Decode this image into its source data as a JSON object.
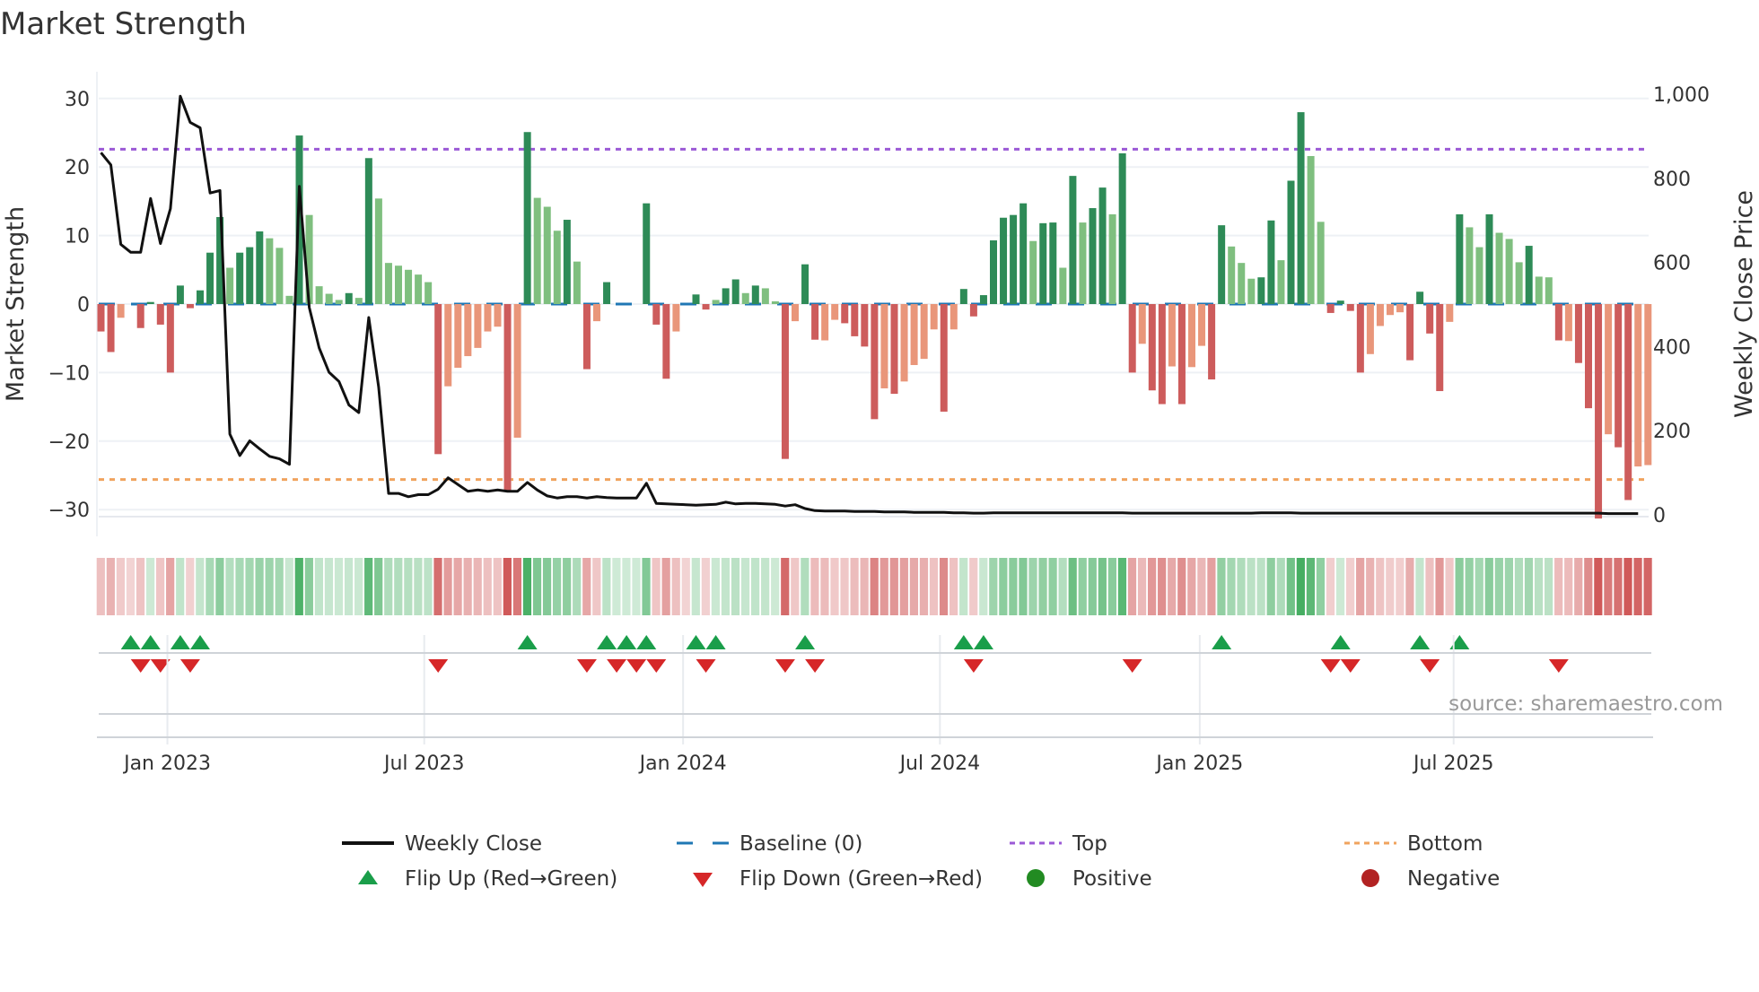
{
  "title": "Market Strength",
  "source": "source: sharemaestro.com",
  "colors": {
    "strong_pos": "#2e8b57",
    "weak_pos": "#7fbf7f",
    "strong_neg": "#cd5c5c",
    "weak_neg": "#e9967a",
    "close": "#111111",
    "baseline": "#1f77b4",
    "top": "#9b59d6",
    "bottom": "#f0a35e",
    "flip_up": "#1a9e4a",
    "flip_down": "#d62728",
    "positive": "#228b22",
    "negative": "#b22222"
  },
  "chart_data": {
    "type": "bar",
    "title": "Market Strength",
    "ylabel": "Market Strength",
    "y2label": "Weekly Close Price",
    "ylim": [
      -31.5,
      31.5
    ],
    "y2lim": [
      0,
      1000
    ],
    "yticks": [
      "30",
      "20",
      "10",
      "0",
      "−10",
      "−20",
      "−30"
    ],
    "ytick_values": [
      30,
      20,
      10,
      0,
      -10,
      -20,
      -30
    ],
    "y2ticks": [
      "1,000",
      "800",
      "600",
      "400",
      "200",
      "0"
    ],
    "y2tick_values": [
      1000,
      800,
      600,
      400,
      200,
      0
    ],
    "xticks": [
      {
        "label": "Jan 2023",
        "week": 6.7
      },
      {
        "label": "Jul 2023",
        "week": 32.6
      },
      {
        "label": "Jan 2024",
        "week": 58.7
      },
      {
        "label": "Jul 2024",
        "week": 84.6
      },
      {
        "label": "Jan 2025",
        "week": 110.8
      },
      {
        "label": "Jul 2025",
        "week": 136.4
      }
    ],
    "top": 22.6,
    "bottom": -25.6,
    "strength": [
      -4,
      -7,
      -2,
      0,
      -3.5,
      0.3,
      -3,
      -10,
      2.7,
      -0.6,
      2,
      7.5,
      12.7,
      5.3,
      7.5,
      8.3,
      10.6,
      9.6,
      8.2,
      1.2,
      24.6,
      13,
      2.6,
      1.5,
      0.6,
      1.6,
      0.9,
      21.3,
      15.4,
      6,
      5.6,
      5,
      4.3,
      3.2,
      -21.9,
      -12,
      -9.3,
      -7.6,
      -6.4,
      -4,
      -3.3,
      -27.2,
      -19.5,
      25.1,
      15.5,
      14.2,
      10.7,
      12.3,
      6.2,
      -9.5,
      -2.5,
      3.2,
      0,
      0,
      0,
      14.7,
      -3,
      -10.9,
      -4,
      0,
      1.4,
      -0.8,
      0.6,
      2.3,
      3.6,
      1.6,
      2.7,
      2.3,
      0.4,
      -22.6,
      -2.5,
      5.8,
      -5.2,
      -5.3,
      -2.3,
      -2.8,
      -4.7,
      -6.2,
      -16.8,
      -12.3,
      -13.1,
      -11.3,
      -8.9,
      -8,
      -3.7,
      -15.7,
      -3.7,
      2.2,
      -1.8,
      1.3,
      9.3,
      12.6,
      13,
      14.7,
      9.2,
      11.8,
      11.9,
      5.3,
      18.7,
      11.9,
      14,
      17,
      13.1,
      22,
      -10,
      -5.8,
      -12.6,
      -14.6,
      -9.1,
      -14.6,
      -9.2,
      -6.1,
      -11,
      11.5,
      8.4,
      6,
      3.7,
      3.9,
      12.2,
      6.4,
      18,
      28,
      21.6,
      12,
      -1.3,
      0.5,
      -1,
      -10,
      -7.3,
      -3.2,
      -1.6,
      -1.2,
      -8.2,
      1.8,
      -4.3,
      -12.7,
      -2.6,
      13.1,
      11.2,
      8.3,
      13.1,
      10.4,
      9.5,
      6.1,
      8.5,
      4,
      3.9,
      -5.3,
      -5.4,
      -8.6,
      -15.2,
      -31.3,
      -19,
      -20.9,
      -28.6,
      -23.7,
      -23.5
    ],
    "strong": "sssssssssssssw sssswwsw wwwsws wwwwwwwswwwwwwswsw wwwsw s sssssswwsw wsswsswswssssswswwwswsssssswsswssswsswsssswsswsswwssssssswswssswwwswwwsssswwssswwwssssswwswwwsswwwsswswsssww",
    "shade": [
      "s",
      "s",
      "w",
      "s",
      "s",
      "s",
      "s",
      "s",
      "s",
      "s",
      "s",
      "s",
      "s",
      "w",
      "s",
      "s",
      "s",
      "w",
      "w",
      "w",
      "s",
      "w",
      "w",
      "w",
      "w",
      "s",
      "w",
      "s",
      "w",
      "w",
      "w",
      "w",
      "w",
      "w",
      "s",
      "w",
      "w",
      "w",
      "w",
      "w",
      "w",
      "s",
      "w",
      "s",
      "w",
      "w",
      "w",
      "s",
      "w",
      "s",
      "w",
      "s",
      "s",
      "s",
      "s",
      "s",
      "s",
      "s",
      "w",
      "s",
      "s",
      "s",
      "w",
      "s",
      "s",
      "w",
      "s",
      "w",
      "w",
      "s",
      "w",
      "s",
      "s",
      "w",
      "w",
      "s",
      "s",
      "s",
      "s",
      "w",
      "s",
      "w",
      "w",
      "w",
      "w",
      "s",
      "w",
      "s",
      "s",
      "s",
      "s",
      "s",
      "s",
      "s",
      "w",
      "s",
      "s",
      "w",
      "s",
      "w",
      "s",
      "s",
      "w",
      "s",
      "s",
      "w",
      "s",
      "s",
      "w",
      "s",
      "w",
      "w",
      "s",
      "s",
      "w",
      "w",
      "w",
      "s",
      "s",
      "w",
      "s",
      "s",
      "w",
      "w",
      "s",
      "s",
      "s",
      "s",
      "w",
      "w",
      "w",
      "w",
      "s",
      "s",
      "s",
      "s",
      "w",
      "s",
      "w",
      "w",
      "s",
      "w",
      "w",
      "w",
      "s",
      "w",
      "w",
      "s",
      "w",
      "s",
      "s",
      "s",
      "w",
      "s",
      "s",
      "w",
      "w"
    ],
    "weekly_close": [
      861,
      832,
      643,
      624,
      624,
      752,
      645,
      728,
      995,
      933,
      920,
      765,
      771,
      192,
      141,
      176,
      157,
      139,
      133,
      120,
      781,
      493,
      397,
      339,
      317,
      261,
      243,
      469,
      304,
      51,
      51,
      43,
      48,
      48,
      61,
      88,
      72,
      56,
      59,
      56,
      59,
      56,
      56,
      77,
      59,
      45,
      40,
      43,
      43,
      40,
      43,
      41,
      40,
      40,
      40,
      75,
      27,
      26,
      25,
      24,
      23,
      24,
      25,
      30,
      26,
      27,
      27,
      26,
      25,
      21,
      24,
      15,
      10,
      9,
      9,
      9,
      8,
      8,
      8,
      7,
      7,
      7,
      6,
      6,
      6,
      6,
      5,
      5,
      4,
      4,
      5,
      5,
      5,
      5,
      5,
      5,
      5,
      5,
      5,
      5,
      5,
      5,
      5,
      5,
      4,
      4,
      4,
      4,
      4,
      4,
      4,
      4,
      4,
      4,
      4,
      4,
      4,
      5,
      5,
      5,
      5,
      4,
      4,
      4,
      4,
      4,
      4,
      4,
      4,
      4,
      4,
      4,
      4,
      4,
      4,
      4,
      4,
      4,
      4,
      4,
      4,
      4,
      4,
      4,
      4,
      4,
      4,
      4,
      4,
      4,
      4,
      4,
      3,
      3,
      3,
      3
    ],
    "flip_up_weeks": [
      3,
      5,
      8,
      10,
      43,
      51,
      53,
      55,
      60,
      62,
      71,
      87,
      89,
      113,
      125,
      133,
      137
    ],
    "flip_down_weeks": [
      4,
      6,
      9,
      34,
      49,
      52,
      54,
      56,
      61,
      69,
      72,
      88,
      104,
      124,
      126,
      134,
      147
    ],
    "legend": [
      {
        "key": "close",
        "label": "Weekly Close"
      },
      {
        "key": "baseline",
        "label": "Baseline (0)"
      },
      {
        "key": "top",
        "label": "Top"
      },
      {
        "key": "bottom",
        "label": "Bottom"
      },
      {
        "key": "flip_up",
        "label": "Flip Up (Red→Green)"
      },
      {
        "key": "flip_down",
        "label": "Flip Down (Green→Red)"
      },
      {
        "key": "positive",
        "label": "Positive"
      },
      {
        "key": "negative",
        "label": "Negative"
      }
    ],
    "legend_position": "bottom-center"
  }
}
